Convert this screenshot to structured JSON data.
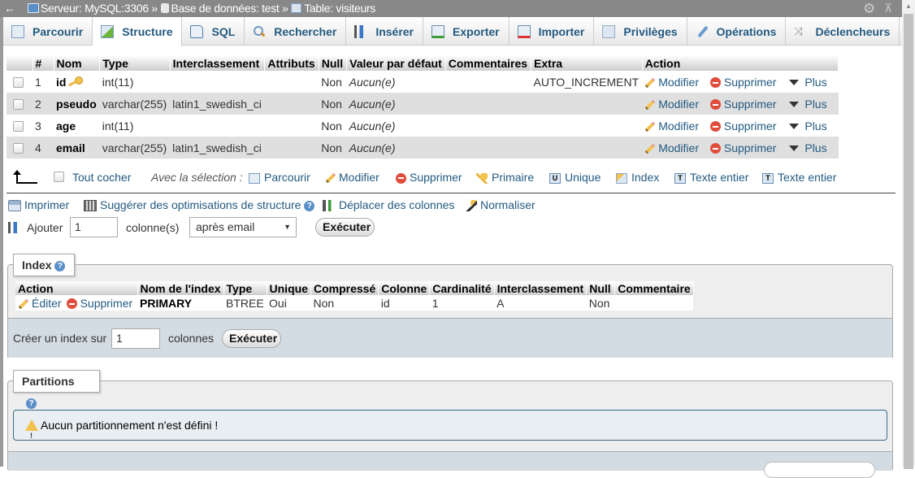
{
  "breadcrumb": {
    "back": "←",
    "server": "Serveur: MySQL:3306",
    "sep": "»",
    "database": "Base de données: test",
    "table": "Table: visiteurs"
  },
  "tabs": [
    {
      "label": "Parcourir",
      "icon": "browse-icon",
      "active": false
    },
    {
      "label": "Structure",
      "icon": "structure-icon",
      "active": true
    },
    {
      "label": "SQL",
      "icon": "sql-icon",
      "active": false
    },
    {
      "label": "Rechercher",
      "icon": "search-icon",
      "active": false
    },
    {
      "label": "Insérer",
      "icon": "insert-icon",
      "active": false
    },
    {
      "label": "Exporter",
      "icon": "export-icon",
      "active": false
    },
    {
      "label": "Importer",
      "icon": "import-icon",
      "active": false
    },
    {
      "label": "Privilèges",
      "icon": "privileges-icon",
      "active": false
    },
    {
      "label": "Opérations",
      "icon": "operations-icon",
      "active": false
    },
    {
      "label": "Déclencheurs",
      "icon": "triggers-icon",
      "active": false
    }
  ],
  "structure": {
    "headers": [
      "#",
      "Nom",
      "Type",
      "Interclassement",
      "Attributs",
      "Null",
      "Valeur par défaut",
      "Commentaires",
      "Extra",
      "Action"
    ],
    "rows": [
      {
        "num": "1",
        "name": "id",
        "primary_key": true,
        "type": "int(11)",
        "collation": "",
        "attributes": "",
        "null": "Non",
        "default": "Aucun(e)",
        "comments": "",
        "extra": "AUTO_INCREMENT"
      },
      {
        "num": "2",
        "name": "pseudo",
        "primary_key": false,
        "type": "varchar(255)",
        "collation": "latin1_swedish_ci",
        "attributes": "",
        "null": "Non",
        "default": "Aucun(e)",
        "comments": "",
        "extra": ""
      },
      {
        "num": "3",
        "name": "age",
        "primary_key": false,
        "type": "int(11)",
        "collation": "",
        "attributes": "",
        "null": "Non",
        "default": "Aucun(e)",
        "comments": "",
        "extra": ""
      },
      {
        "num": "4",
        "name": "email",
        "primary_key": false,
        "type": "varchar(255)",
        "collation": "latin1_swedish_ci",
        "attributes": "",
        "null": "Non",
        "default": "Aucun(e)",
        "comments": "",
        "extra": ""
      }
    ],
    "actions": {
      "modify": "Modifier",
      "delete": "Supprimer",
      "more": "Plus"
    }
  },
  "bulk": {
    "check_all": "Tout cocher",
    "with_selection": "Avec la sélection :",
    "browse": "Parcourir",
    "modify": "Modifier",
    "delete": "Supprimer",
    "primary": "Primaire",
    "unique": "Unique",
    "index": "Index",
    "fulltext1": "Texte entier",
    "fulltext2": "Texte entier"
  },
  "tools": {
    "print": "Imprimer",
    "propose": "Suggérer des optimisations de structure",
    "move": "Déplacer des colonnes",
    "normalize": "Normaliser"
  },
  "add_column": {
    "label": "Ajouter",
    "count": "1",
    "unit": "colonne(s)",
    "position": "après email",
    "execute": "Exécuter"
  },
  "indexes": {
    "legend": "Index",
    "headers": [
      "Action",
      "Nom de l'index",
      "Type",
      "Unique",
      "Compressé",
      "Colonne",
      "Cardinalité",
      "Interclassement",
      "Null",
      "Commentaire"
    ],
    "rows": [
      {
        "edit": "Éditer",
        "delete": "Supprimer",
        "name": "PRIMARY",
        "type": "BTREE",
        "unique": "Oui",
        "packed": "Non",
        "column": "id",
        "cardinality": "1",
        "collation": "A",
        "null": "Non",
        "comment": ""
      }
    ],
    "create_label": "Créer un index sur",
    "create_count": "1",
    "create_unit": "colonnes",
    "execute": "Exécuter"
  },
  "partitions": {
    "legend": "Partitions",
    "notice": "Aucun partitionnement n'est défini !"
  },
  "colors": {
    "link": "#235a81",
    "topbar": "#888888",
    "row_alt": "#dfdfdf",
    "footer": "#d3dce3"
  }
}
